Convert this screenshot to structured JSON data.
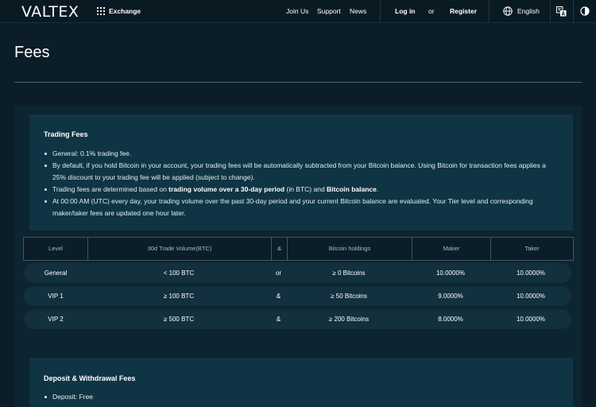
{
  "header": {
    "logo": "VALTEX",
    "exchange_label": "Exchange",
    "nav": {
      "join_us": "Join Us",
      "support": "Support",
      "news": "News"
    },
    "login": "Log in",
    "or": "or",
    "register": "Register",
    "language": "English",
    "icons": [
      "grid-icon",
      "globe-icon",
      "translate-icon",
      "theme-toggle-icon"
    ]
  },
  "page": {
    "title": "Fees"
  },
  "trading_fees": {
    "title": "Trading Fees",
    "b1": "General: 0.1% trading fee.",
    "b2": "By default, if you hold Bitcoin in your account, your trading fees will be automatically subtracted from your Bitcoin balance. Using Bitcoin for transaction fees applies a 25% discount to your trading fee will be applied (subject to change).",
    "b3_pre": "Trading fees are determined based on ",
    "b3_bold1": "trading volume over a 30-day period",
    "b3_mid": " (in BTC) and ",
    "b3_bold2": "Bitcoin balance",
    "b3_post": ".",
    "b4": "At 00:00 AM (UTC) every day, your trading volume over the past 30-day period and your current Bitcoin balance are evaluated. Your Tier level and corresponding maker/taker fees are updated one hour later."
  },
  "fee_table": {
    "headers": {
      "level": "Level",
      "volume": "30d Trade Volume(BTC)",
      "op": "&",
      "holdings": "Bitcoin holdings",
      "maker": "Maker",
      "taker": "Taker"
    },
    "rows": [
      {
        "level": "General",
        "volume": "< 100 BTC",
        "op": "or",
        "holdings": "≥ 0 Bitcoins",
        "maker": "10.0000%",
        "taker": "10.0000%"
      },
      {
        "level": "VIP 1",
        "volume": "≥ 100 BTC",
        "op": "&",
        "holdings": "≥ 50 Bitcoins",
        "maker": "9.0000%",
        "taker": "10.0000%"
      },
      {
        "level": "VIP 2",
        "volume": "≥ 500 BTC",
        "op": "&",
        "holdings": "≥ 200 Bitcoins",
        "maker": "8.0000%",
        "taker": "10.0000%"
      }
    ]
  },
  "deposit_fees": {
    "title": "Deposit & Withdrawal Fees",
    "b1": "Deposit: Free"
  }
}
